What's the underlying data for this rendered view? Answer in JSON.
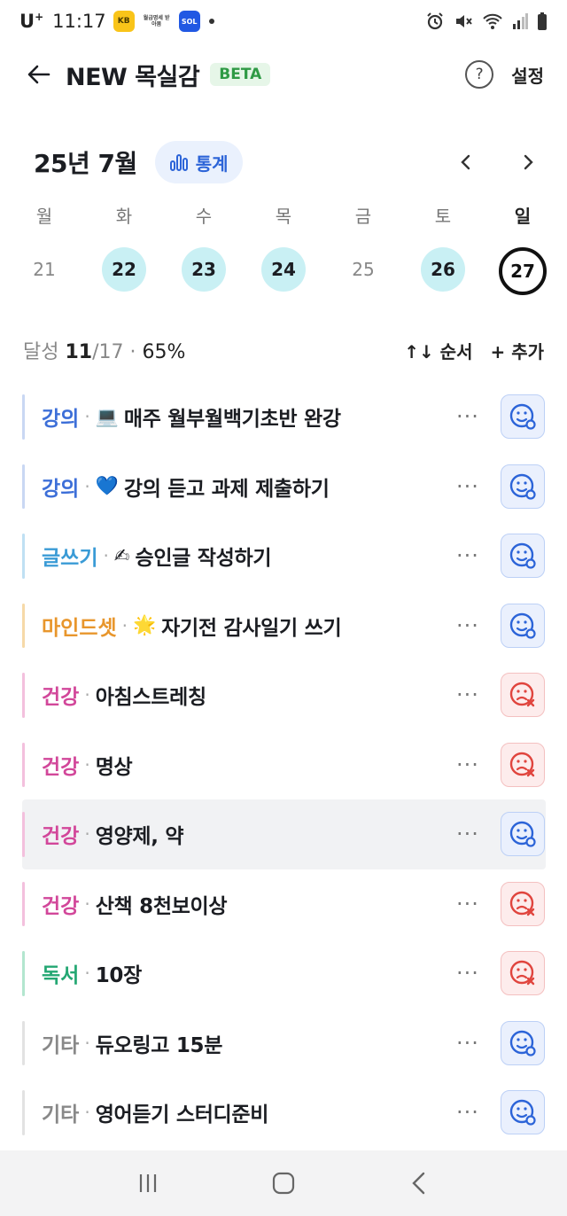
{
  "status_bar": {
    "carrier": "U",
    "carrier_sup": "+",
    "time": "11:17",
    "notif_kb": "KB",
    "notif_card": "월급명세 받아봄",
    "notif_sol": "SOL"
  },
  "header": {
    "title": "NEW 목실감",
    "badge": "BETA",
    "help": "?",
    "settings": "설정"
  },
  "calendar": {
    "month": "25년 7월",
    "stats_label": "통계",
    "weekdays": [
      "월",
      "화",
      "수",
      "목",
      "금",
      "토",
      "일"
    ],
    "dates": [
      "21",
      "22",
      "23",
      "24",
      "25",
      "26",
      "27"
    ]
  },
  "summary": {
    "prefix": "달성",
    "done": "11",
    "total": "/17",
    "dot": "·",
    "percent": "65%",
    "order": "↑↓ 순서",
    "add": "+ 추가"
  },
  "colors": {
    "lecture": "#3d6fd8",
    "writing": "#3a9bd6",
    "mindset": "#e8962c",
    "health": "#d2479a",
    "reading": "#24a773",
    "etc": "#888888"
  },
  "habits": [
    {
      "category": "강의",
      "emoji": "💻",
      "name": "매주 월부월백기초반 완강",
      "status": "ok"
    },
    {
      "category": "강의",
      "emoji": "💙",
      "name": "강의 듣고 과제 제출하기",
      "status": "ok"
    },
    {
      "category": "글쓰기",
      "emoji": "✍",
      "name": "승인글 작성하기",
      "status": "ok"
    },
    {
      "category": "마인드셋",
      "emoji": "🌟",
      "name": "자기전 감사일기 쓰기",
      "status": "ok"
    },
    {
      "category": "건강",
      "emoji": "",
      "name": "아침스트레칭",
      "status": "fail"
    },
    {
      "category": "건강",
      "emoji": "",
      "name": "명상",
      "status": "fail"
    },
    {
      "category": "건강",
      "emoji": "",
      "name": "영양제, 약",
      "status": "ok"
    },
    {
      "category": "건강",
      "emoji": "",
      "name": "산책 8천보이상",
      "status": "fail"
    },
    {
      "category": "독서",
      "emoji": "",
      "name": "10장",
      "status": "fail"
    },
    {
      "category": "기타",
      "emoji": "",
      "name": "듀오링고 15분",
      "status": "ok"
    },
    {
      "category": "기타",
      "emoji": "",
      "name": "영어듣기 스터디준비",
      "status": "ok"
    }
  ],
  "habit_separator": "·",
  "more_label": "···"
}
